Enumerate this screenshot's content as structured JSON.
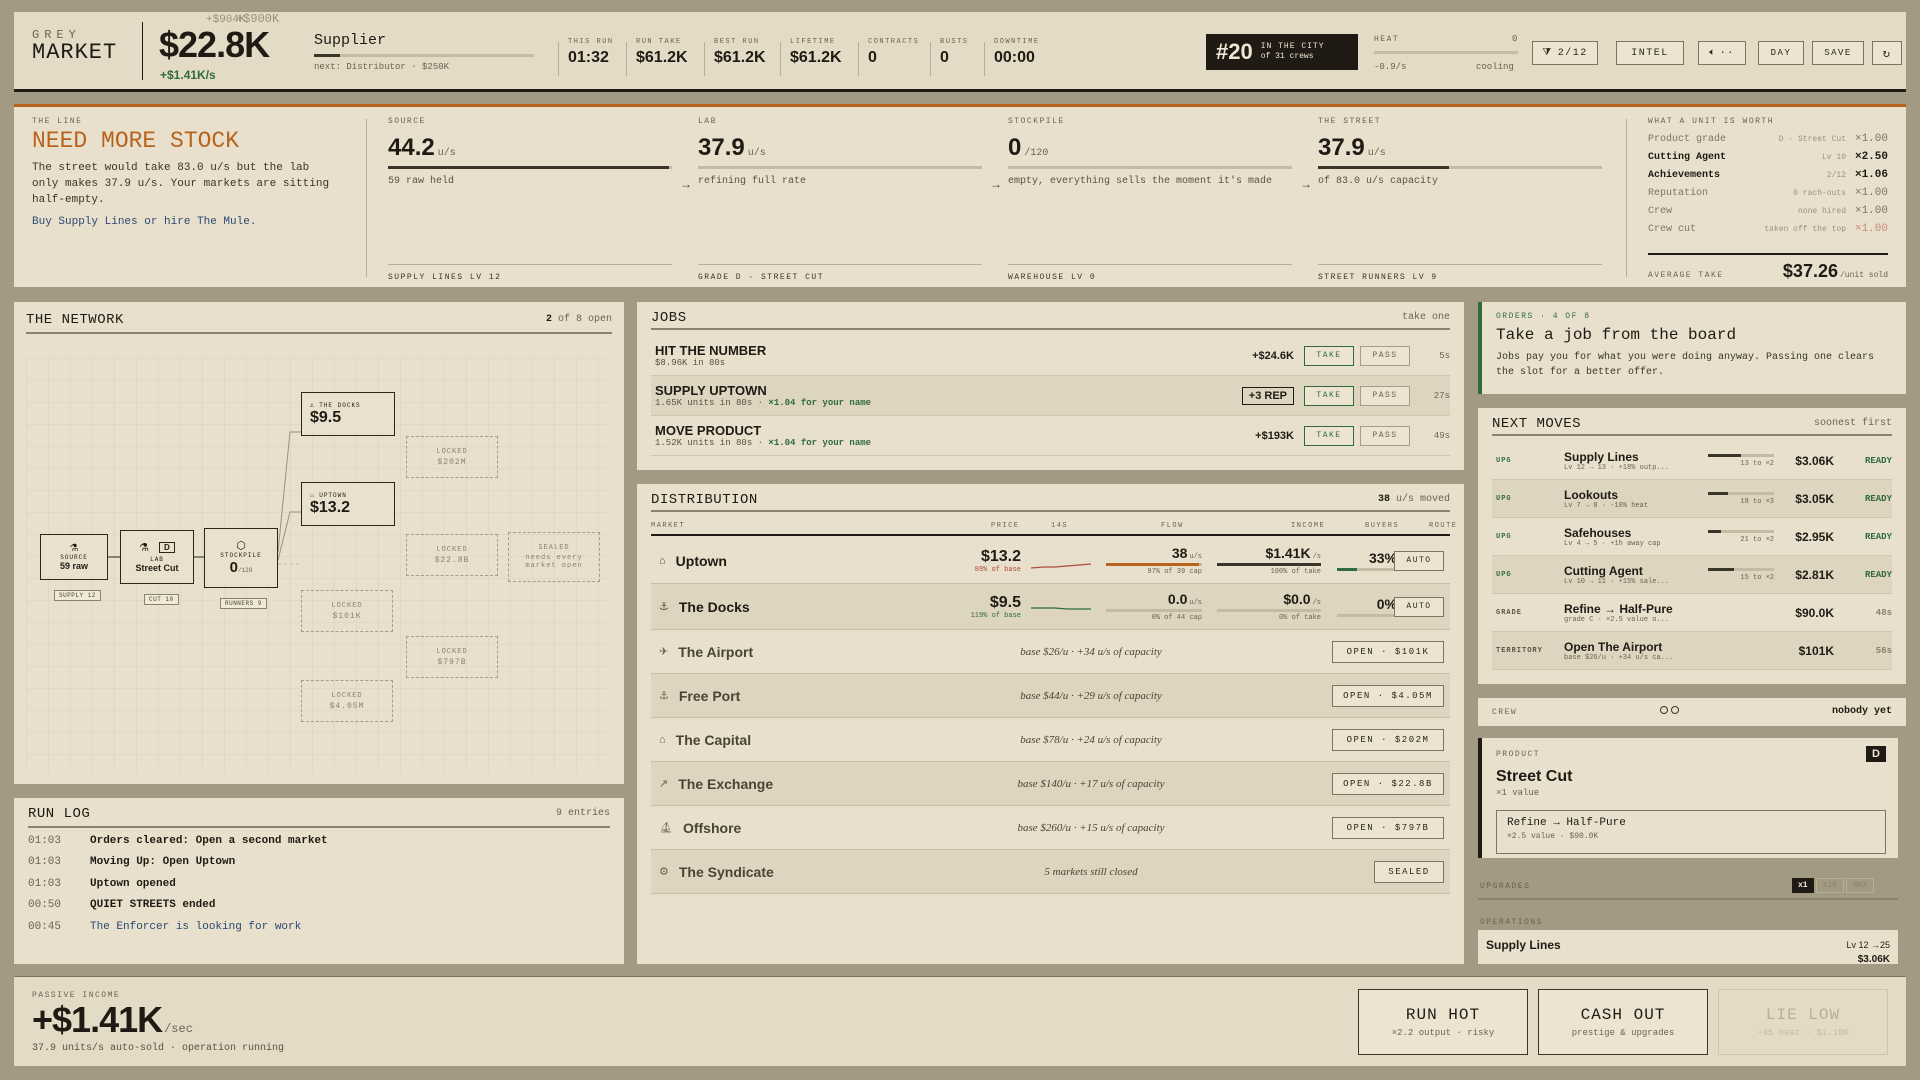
{
  "top": {
    "brand_top": "GREY",
    "brand": "MARKET",
    "cash": "$22.8K",
    "cash_ghost_a": "+$900K",
    "cash_ghost_b": "+$904K",
    "rate": "+$1.41K/s",
    "rank_title": "Supplier",
    "rank_next": "next: Distributor · $250K",
    "rank_progress": 0.12,
    "stats": [
      {
        "label": "THIS RUN",
        "value": "01:32"
      },
      {
        "label": "RUN TAKE",
        "value": "$61.2K"
      },
      {
        "label": "BEST RUN",
        "value": "$61.2K"
      },
      {
        "label": "LIFETIME",
        "value": "$61.2K"
      },
      {
        "label": "CONTRACTS",
        "value": "0"
      },
      {
        "label": "BUSTS",
        "value": "0"
      },
      {
        "label": "DOWNTIME",
        "value": "00:00"
      }
    ],
    "city_rank": "#20",
    "city_line1": "IN THE CITY",
    "city_line2": "of 31 crews",
    "heat_label": "HEAT",
    "heat_value": "0",
    "heat_rate": "-0.9/s",
    "heat_state": "cooling",
    "filter_label": "2/12",
    "intel": "INTEL",
    "sound": "··",
    "day": "DAY",
    "save": "SAVE"
  },
  "line": {
    "label": "THE LINE",
    "title": "NEED MORE STOCK",
    "body": "The street would take 83.0 u/s but the lab only makes 37.9 u/s. Your markets are sitting half-empty.",
    "hint": "Buy Supply Lines or hire The Mule."
  },
  "stages": [
    {
      "label": "SOURCE",
      "value": "44.2",
      "unit": "u/s",
      "bar": 0.99,
      "sub": "59 raw held",
      "foot": "SUPPLY LINES Lv 12"
    },
    {
      "label": "LAB",
      "value": "37.9",
      "unit": "u/s",
      "bar": 0,
      "sub": "refining full rate",
      "foot": "GRADE D · STREET CUT"
    },
    {
      "label": "STOCKPILE",
      "value": "0",
      "unit": "/120",
      "bar": 0,
      "sub": "empty, everything sells the moment it's made",
      "foot": "WAREHOUSE Lv 0"
    },
    {
      "label": "THE STREET",
      "value": "37.9",
      "unit": "u/s",
      "bar": 0.46,
      "sub": "of 83.0 u/s capacity",
      "foot": "STREET RUNNERS Lv 9"
    }
  ],
  "worth": {
    "label": "WHAT A UNIT IS WORTH",
    "rows": [
      {
        "name": "Product grade",
        "note": "D · Street Cut",
        "mult": "×1.00",
        "dim": true
      },
      {
        "name": "Cutting Agent",
        "note": "Lv 10",
        "mult": "×2.50",
        "dim": false
      },
      {
        "name": "Achievements",
        "note": "2/12",
        "mult": "×1.06",
        "dim": false
      },
      {
        "name": "Reputation",
        "note": "0 rach-outs",
        "mult": "×1.00",
        "dim": true
      },
      {
        "name": "Crew",
        "note": "none hired",
        "mult": "×1.00",
        "dim": true
      },
      {
        "name": "Crew cut",
        "note": "taken off the top",
        "mult": "×1.00",
        "dim": true,
        "red": true
      }
    ],
    "avg_label": "AVERAGE TAKE",
    "avg": "$37.26",
    "avg_unit": "/unit sold"
  },
  "network": {
    "title": "THE NETWORK",
    "count": "2",
    "of": "of 8 open",
    "source": {
      "label": "SOURCE",
      "val": "59 raw"
    },
    "lab": {
      "label": "LAB",
      "val": "Street Cut",
      "badge": "D"
    },
    "stock": {
      "label": "STOCKPILE",
      "val": "0",
      "unit": "/120"
    },
    "docks": {
      "label": "THE DOCKS",
      "val": "$9.5"
    },
    "uptown": {
      "label": "UPTOWN",
      "val": "$13.2"
    },
    "locks": [
      {
        "l": "LOCKED",
        "v": "$202M"
      },
      {
        "l": "LOCKED",
        "v": "$22.8B"
      },
      {
        "l": "LOCKED",
        "v": "$101K"
      },
      {
        "l": "LOCKED",
        "v": "$797B"
      },
      {
        "l": "LOCKED",
        "v": "$4.05M"
      }
    ],
    "sealed": {
      "l": "SEALED",
      "v": "needs every market open"
    },
    "chips": [
      "SUPPLY 12",
      "CUT 10",
      "RUNNERS 9"
    ]
  },
  "log": {
    "title": "RUN LOG",
    "count": "9 entries",
    "rows": [
      {
        "t": "01:03",
        "e": "Orders cleared: Open a second market",
        "link": false
      },
      {
        "t": "01:03",
        "e": "Moving Up: Open Uptown",
        "link": false
      },
      {
        "t": "01:03",
        "e": "Uptown opened",
        "link": false
      },
      {
        "t": "00:50",
        "e": "QUIET STREETS ended",
        "link": false
      },
      {
        "t": "00:45",
        "e": "The Enforcer is looking for work",
        "link": true
      }
    ]
  },
  "jobs": {
    "title": "JOBS",
    "hint": "take one",
    "take": "TAKE",
    "pass": "PASS",
    "rows": [
      {
        "title": "HIT THE NUMBER",
        "desc": "$8.96K in 80s",
        "bonus": "",
        "reward": "+$24.6K",
        "boxed": false,
        "timer": "5s"
      },
      {
        "title": "SUPPLY UPTOWN",
        "desc": "1.65K units in 80s · ",
        "bonus": "×1.04 for your name",
        "reward": "+3 REP",
        "boxed": true,
        "timer": "27s"
      },
      {
        "title": "MOVE PRODUCT",
        "desc": "1.52K units in 80s · ",
        "bonus": "×1.04 for your name",
        "reward": "+$193K",
        "boxed": false,
        "timer": "49s"
      }
    ]
  },
  "dist": {
    "title": "DISTRIBUTION",
    "moved": "38",
    "moved_unit": "u/s moved",
    "cols": [
      "MARKET",
      "PRICE",
      "14S",
      "FLOW",
      "INCOME",
      "BUYERS",
      "ROUTE"
    ],
    "open": [
      {
        "name": "Uptown",
        "price": "$13.2",
        "pct": "88% of base",
        "flow": "38",
        "flow_sub": "97% of 39 cap",
        "flowbar": 0.97,
        "income": "$1.41K",
        "inc_sub": "100% of take",
        "incbar": 1.0,
        "buyers": "33%",
        "buyerbar": 0.33,
        "route": "AUTO",
        "spark": [
          20,
          19,
          19,
          18,
          17,
          16
        ]
      },
      {
        "name": "The Docks",
        "price": "$9.5",
        "pct": "119% of base",
        "flow": "0.0",
        "flow_sub": "0% of 44 cap",
        "flowbar": 0,
        "income": "$0.0",
        "inc_sub": "0% of take",
        "incbar": 0,
        "buyers": "0%",
        "buyerbar": 0,
        "route": "AUTO",
        "spark": [
          14,
          14,
          14,
          15,
          15,
          15
        ]
      }
    ],
    "closed": [
      {
        "name": "The Airport",
        "desc": "base $26/u · +34 u/s of capacity",
        "btn": "OPEN · $101K"
      },
      {
        "name": "Free Port",
        "desc": "base $44/u · +29 u/s of capacity",
        "btn": "OPEN · $4.05M"
      },
      {
        "name": "The Capital",
        "desc": "base $78/u · +24 u/s of capacity",
        "btn": "OPEN · $202M"
      },
      {
        "name": "The Exchange",
        "desc": "base $140/u · +17 u/s of capacity",
        "btn": "OPEN · $22.8B"
      },
      {
        "name": "Offshore",
        "desc": "base $260/u · +15 u/s of capacity",
        "btn": "OPEN · $797B"
      }
    ],
    "sealed": {
      "name": "The Syndicate",
      "desc": "5 markets still closed",
      "btn": "SEALED"
    }
  },
  "orders": {
    "label": "ORDERS · 4 OF 8",
    "title": "Take a job from the board",
    "body": "Jobs pay you for what you were doing anyway. Passing one clears the slot for a better offer."
  },
  "moves": {
    "title": "NEXT MOVES",
    "hint": "soonest first",
    "rows": [
      {
        "tag": "UPG",
        "name": "Supply Lines",
        "desc": "Lv 12 → 13 · +18% outp...",
        "lv": "13 to ×2",
        "bar": 0.5,
        "price": "$3.06K",
        "state": "READY"
      },
      {
        "tag": "UPG",
        "name": "Lookouts",
        "desc": "Lv 7 → 8 · -10% heat",
        "lv": "18 to ×3",
        "bar": 0.3,
        "price": "$3.05K",
        "state": "READY"
      },
      {
        "tag": "UPG",
        "name": "Safehouses",
        "desc": "Lv 4 → 5 · +1h away cap",
        "lv": "21 to ×2",
        "bar": 0.2,
        "price": "$2.95K",
        "state": "READY"
      },
      {
        "tag": "UPG",
        "name": "Cutting Agent",
        "desc": "Lv 10 → 11 · +15% sale...",
        "lv": "15 to ×2",
        "bar": 0.4,
        "price": "$2.81K",
        "state": "READY"
      },
      {
        "tag": "GRADE",
        "name": "Refine → Half-Pure",
        "desc": "grade C · ×2.5 value o...",
        "lv": "",
        "bar": -1,
        "price": "$90.0K",
        "state": "48s"
      },
      {
        "tag": "TERRITORY",
        "name": "Open The Airport",
        "desc": "base $26/u · +34 u/s ca...",
        "lv": "",
        "bar": -1,
        "price": "$101K",
        "state": "56s"
      }
    ]
  },
  "crew": {
    "label": "CREW",
    "state": "nobody yet"
  },
  "product": {
    "label": "PRODUCT",
    "grade": "D",
    "name": "Street Cut",
    "value": "×1 value",
    "next_name": "Refine → Half-Pure",
    "next_desc": "×2.5 value · $90.0K"
  },
  "upgrades": {
    "label": "UPGRADES",
    "opts": [
      "x1",
      "x10",
      "MAX"
    ]
  },
  "ops": {
    "label": "OPERATIONS",
    "name": "Supply Lines",
    "lv": "Lv 12 →25",
    "price": "$3.06K"
  },
  "passive": {
    "label": "PASSIVE INCOME",
    "value": "+$1.41K",
    "unit": "/sec",
    "sub": "37.9 units/s auto-sold · operation running"
  },
  "actions": [
    {
      "label": "RUN HOT",
      "sub": "×2.2 output · risky",
      "dim": false
    },
    {
      "label": "CASH OUT",
      "sub": "prestige & upgrades",
      "dim": false
    },
    {
      "label": "LIE LOW",
      "sub": "-45 heat · $1.10K",
      "dim": true
    }
  ],
  "colors": {
    "accent": "#b8631c",
    "green": "#2f6b3f",
    "red": "#b04a3a",
    "ink": "#1f1b14",
    "paper": "#e8e0cc",
    "bg": "#a39a83"
  }
}
